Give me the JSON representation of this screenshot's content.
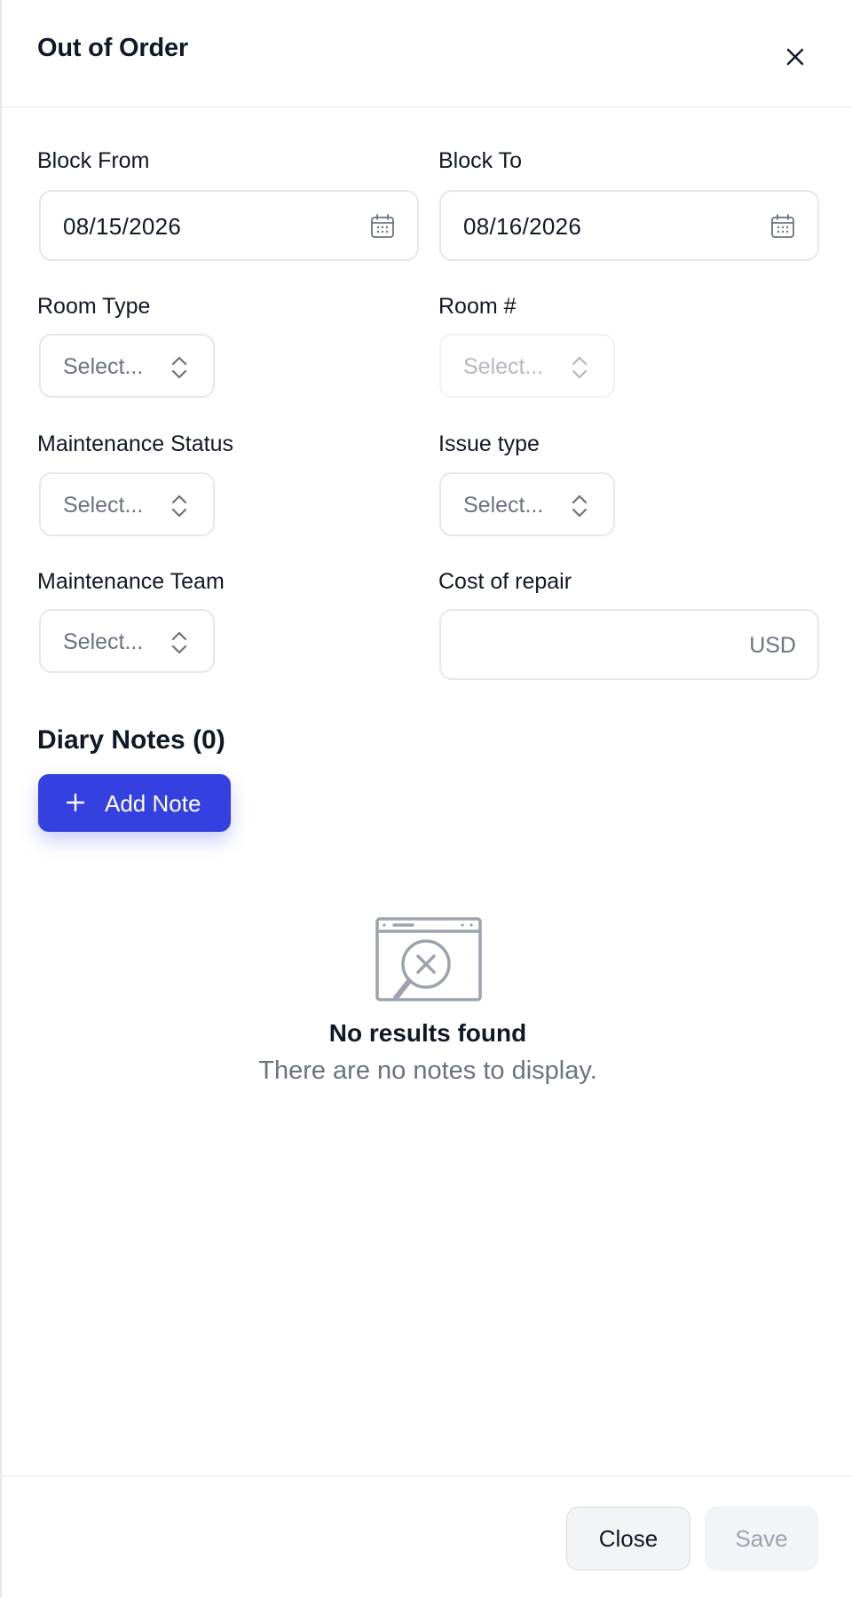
{
  "header": {
    "title": "Out of Order",
    "close_icon": "close-icon"
  },
  "form": {
    "block_from": {
      "label": "Block From",
      "value": "08/15/2026",
      "icon": "calendar-icon"
    },
    "block_to": {
      "label": "Block To",
      "value": "08/16/2026",
      "icon": "calendar-icon"
    },
    "room_type": {
      "label": "Room Type",
      "placeholder": "Select...",
      "icon": "chevron-up-down-icon"
    },
    "room_number": {
      "label": "Room #",
      "placeholder": "Select...",
      "disabled": true,
      "icon": "chevron-up-down-icon"
    },
    "maintenance_status": {
      "label": "Maintenance Status",
      "placeholder": "Select...",
      "icon": "chevron-up-down-icon"
    },
    "issue_type": {
      "label": "Issue type",
      "placeholder": "Select...",
      "icon": "chevron-up-down-icon"
    },
    "maintenance_team": {
      "label": "Maintenance Team",
      "placeholder": "Select...",
      "icon": "chevron-up-down-icon"
    },
    "cost_of_repair": {
      "label": "Cost of repair",
      "value": "",
      "unit": "USD"
    }
  },
  "diary": {
    "title": "Diary Notes (0)",
    "add_button": "Add Note",
    "empty_title": "No results found",
    "empty_message": "There are no notes to display.",
    "empty_icon": "search-not-found-icon"
  },
  "footer": {
    "close_label": "Close",
    "save_label": "Save",
    "save_disabled": true
  },
  "colors": {
    "accent": "#3440e0",
    "border": "#e5e7eb",
    "muted_text": "#6b7280"
  }
}
